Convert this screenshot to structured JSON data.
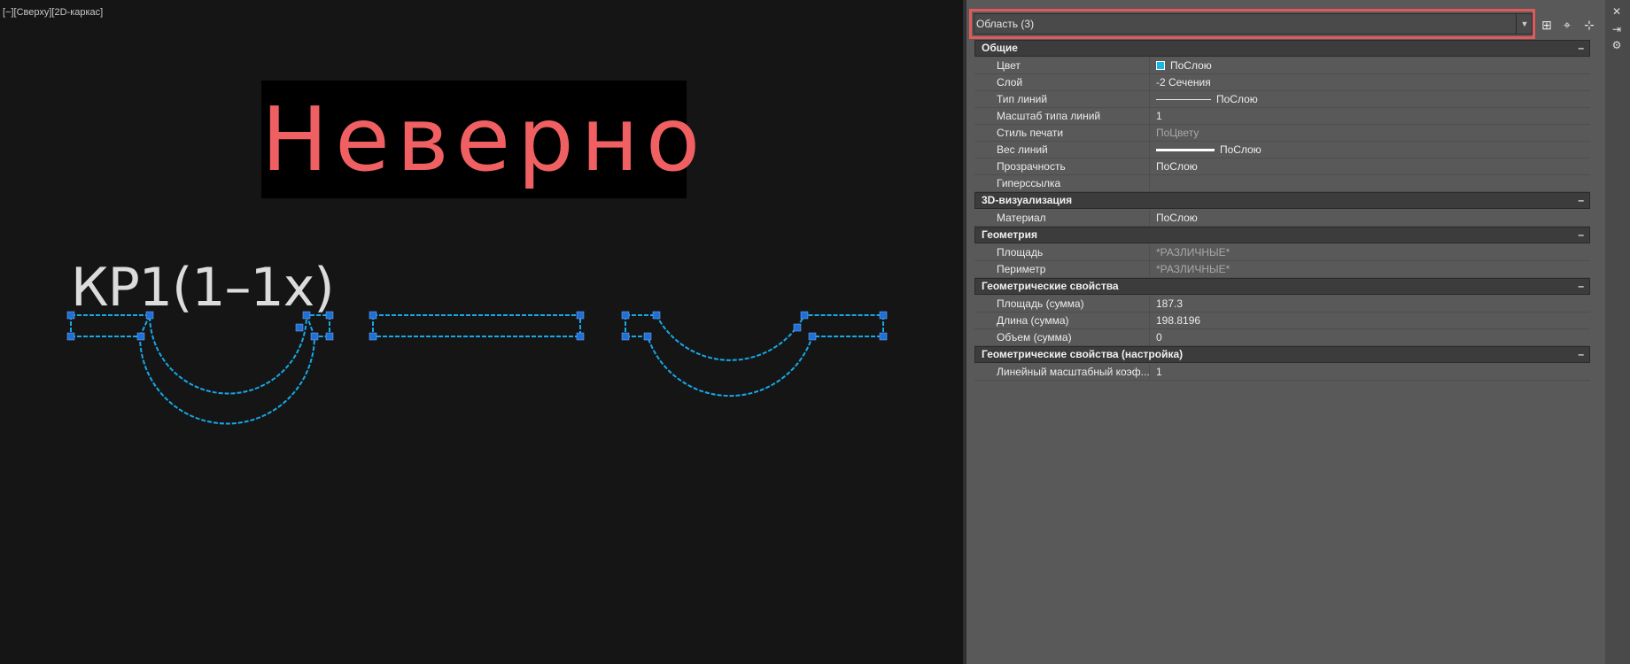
{
  "viewport": {
    "label": "[−][Сверху][2D-каркас]",
    "banner_text": "Неверно",
    "cad_text": "КР1(1–1х)",
    "colors": {
      "background": "#151515",
      "selection": "#17a8e6",
      "grip": "#1f6fd6",
      "banner_text": "#f06062"
    }
  },
  "properties": {
    "selector": {
      "value": "Область (3)"
    },
    "toolbar": [
      {
        "name": "quick-select-icon",
        "glyph": "⊞"
      },
      {
        "name": "select-objects-icon",
        "glyph": "⌖"
      },
      {
        "name": "pickadd-icon",
        "glyph": "⊹"
      }
    ],
    "strip": [
      {
        "name": "close-panel-icon",
        "glyph": "✕"
      },
      {
        "name": "auto-hide-icon",
        "glyph": "⇥"
      },
      {
        "name": "panel-settings-icon",
        "glyph": "⚙"
      }
    ],
    "sections": [
      {
        "title": "Общие",
        "collapse": "–",
        "rows": [
          {
            "name": "Цвет",
            "value": "ПоСлою",
            "decor": "swatch"
          },
          {
            "name": "Слой",
            "value": "-2 Сечения"
          },
          {
            "name": "Тип линий",
            "value": "ПоСлою",
            "decor": "ltype"
          },
          {
            "name": "Масштаб типа линий",
            "value": "1"
          },
          {
            "name": "Стиль печати",
            "value": "ПоЦвету",
            "dim": true
          },
          {
            "name": "Вес линий",
            "value": "ПоСлою",
            "decor": "lweight"
          },
          {
            "name": "Прозрачность",
            "value": "ПоСлою"
          },
          {
            "name": "Гиперссылка",
            "value": ""
          }
        ]
      },
      {
        "title": "3D-визуализация",
        "collapse": "–",
        "rows": [
          {
            "name": "Материал",
            "value": "ПоСлою"
          }
        ]
      },
      {
        "title": "Геометрия",
        "collapse": "–",
        "rows": [
          {
            "name": "Площадь",
            "value": "*РАЗЛИЧНЫЕ*",
            "dim": true
          },
          {
            "name": "Периметр",
            "value": "*РАЗЛИЧНЫЕ*",
            "dim": true
          }
        ]
      },
      {
        "title": "Геометрические свойства",
        "collapse": "–",
        "rows": [
          {
            "name": "Площадь (сумма)",
            "value": "187.3"
          },
          {
            "name": "Длина (сумма)",
            "value": "198.8196"
          },
          {
            "name": "Объем (сумма)",
            "value": "0"
          }
        ]
      },
      {
        "title": "Геометрические свойства (настройка)",
        "collapse": "–",
        "rows": [
          {
            "name": "Линейный масштабный коэф...",
            "value": "1"
          }
        ]
      }
    ]
  }
}
